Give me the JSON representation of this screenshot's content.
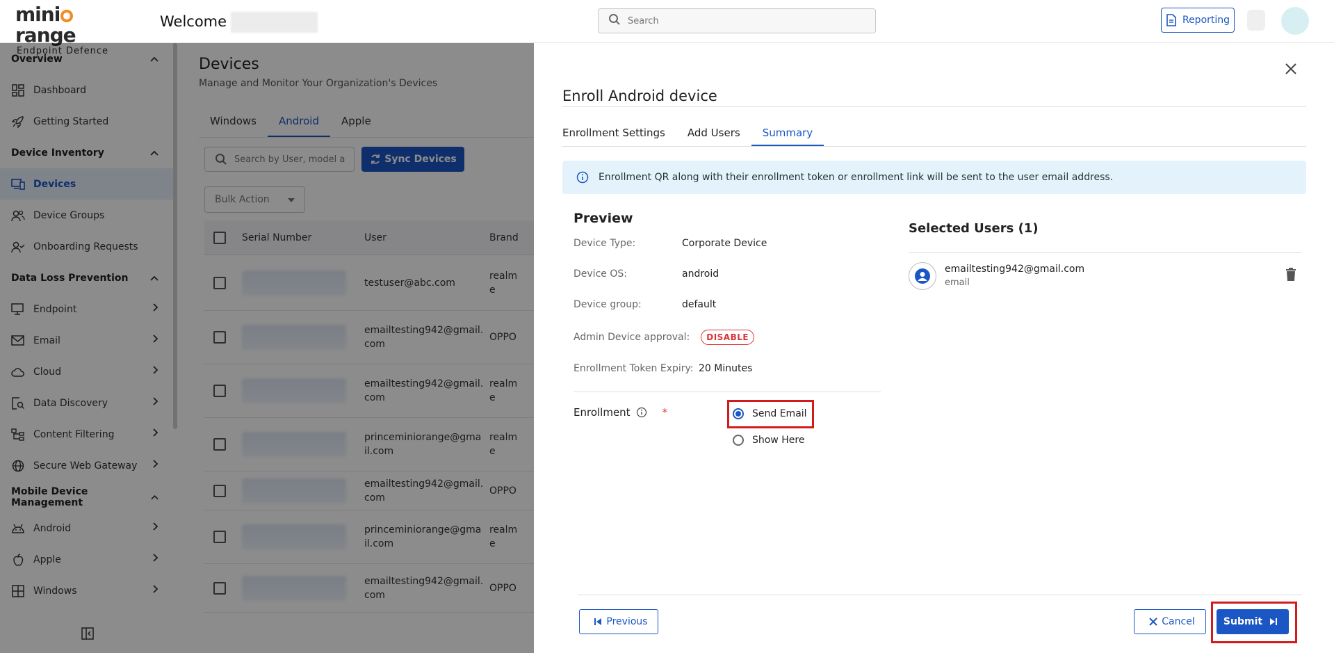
{
  "header": {
    "logo_main": "miniOrange",
    "logo_main_left": "mini",
    "logo_main_right": "range",
    "logo_sub": "Endpoint Defence",
    "welcome": "Welcome",
    "search_placeholder": "Search",
    "reporting_label": "Reporting"
  },
  "sidebar": {
    "sections": [
      {
        "label": "Overview",
        "items": [
          "Dashboard",
          "Getting Started"
        ]
      },
      {
        "label": "Device Inventory",
        "items": [
          "Devices",
          "Device Groups",
          "Onboarding Requests"
        ]
      },
      {
        "label": "Data Loss Prevention",
        "items": [
          "Endpoint",
          "Email",
          "Cloud",
          "Data Discovery",
          "Content Filtering",
          "Secure Web Gateway"
        ]
      },
      {
        "label": "Mobile Device Management",
        "items": [
          "Android",
          "Apple",
          "Windows"
        ]
      }
    ],
    "active_item": "Devices"
  },
  "main": {
    "title": "Devices",
    "subtitle": "Manage and Monitor Your Organization's Devices",
    "platform_tabs": [
      "Windows",
      "Android",
      "Apple"
    ],
    "active_platform": "Android",
    "search_placeholder": "Search by User, model a",
    "sync_label": "Sync Devices",
    "bulk_action": "Bulk Action",
    "columns": [
      "Serial Number",
      "User",
      "Brand"
    ],
    "rows": [
      {
        "user": "testuser@abc.com",
        "brand": "realme"
      },
      {
        "user": "emailtesting942@gmail.com",
        "brand": "OPPO"
      },
      {
        "user": "emailtesting942@gmail.com",
        "brand": "realme"
      },
      {
        "user": "princeminiorange@gmail.com",
        "brand": "realme"
      },
      {
        "user": "emailtesting942@gmail.com",
        "brand": "OPPO"
      },
      {
        "user": "princeminiorange@gmail.com",
        "brand": "realme"
      },
      {
        "user": "emailtesting942@gmail.com",
        "brand": "OPPO"
      }
    ]
  },
  "panel": {
    "title": "Enroll Android device",
    "tabs": [
      "Enrollment Settings",
      "Add Users",
      "Summary"
    ],
    "active_tab": "Summary",
    "info_text": "Enrollment QR along with their enrollment token or enrollment link will be sent to the user email address.",
    "preview_heading": "Preview",
    "device_type_label": "Device Type:",
    "device_type_value": "Corporate Device",
    "device_os_label": "Device OS:",
    "device_os_value": "android",
    "device_group_label": "Device group:",
    "device_group_value": "default",
    "admin_approval_label": "Admin Device approval:",
    "admin_approval_value": "DISABLE",
    "token_expiry_label": "Enrollment Token Expiry:",
    "token_expiry_value": "20 Minutes",
    "enrollment_label": "Enrollment",
    "required_mark": "*",
    "option_send_email": "Send Email",
    "option_show_here": "Show Here",
    "selected_option": "Send Email",
    "selected_users_heading": "Selected Users (1)",
    "user_email": "emailtesting942@gmail.com",
    "user_type": "email",
    "previous_label": "Previous",
    "cancel_label": "Cancel",
    "submit_label": "Submit"
  },
  "colors": {
    "accent": "#1a56c4",
    "danger": "#d21c1c",
    "brand_orange": "#f58a24",
    "info_bg": "#e4f3fb"
  }
}
